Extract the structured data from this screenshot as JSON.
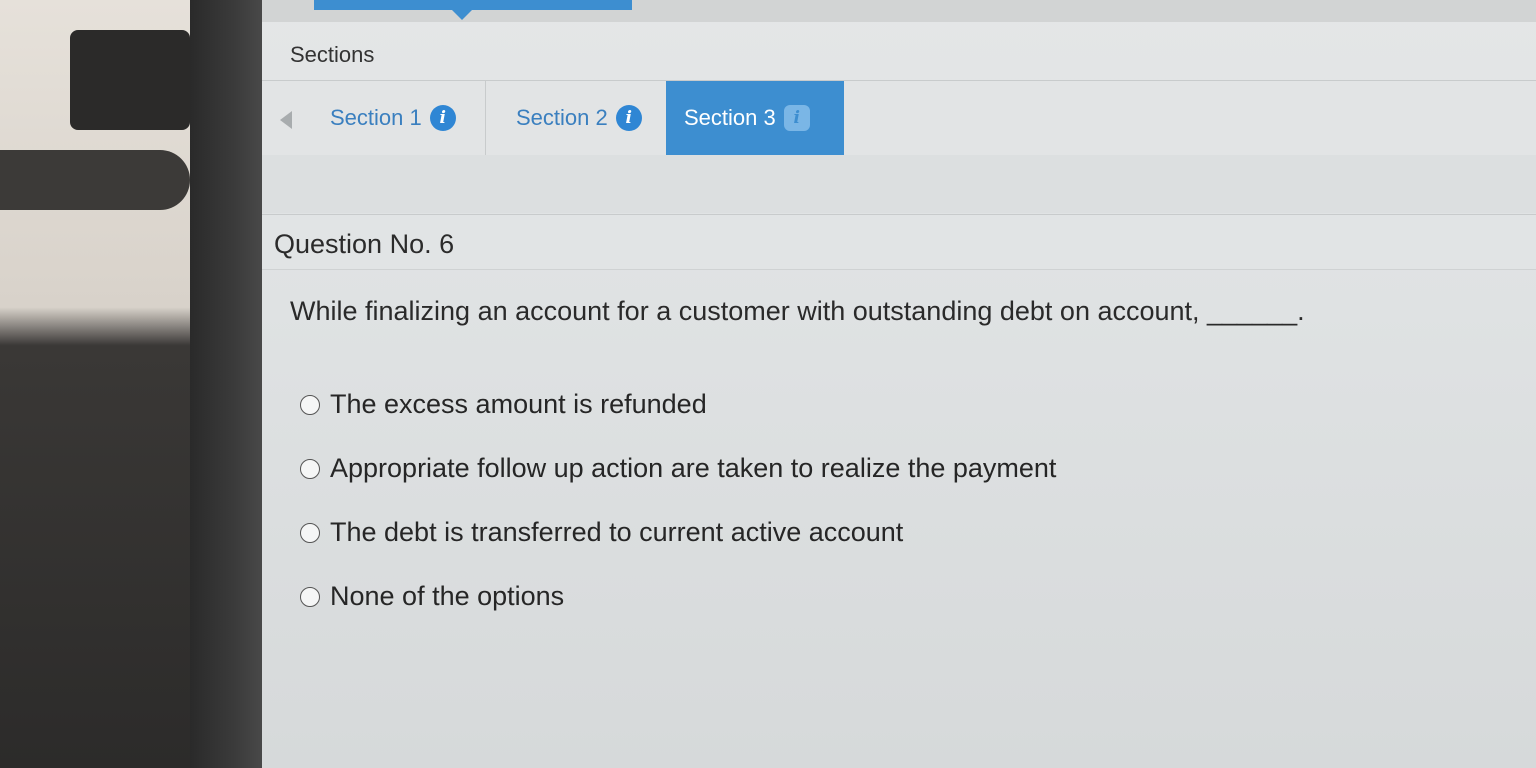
{
  "sections_title": "Sections",
  "tabs": [
    {
      "label": "Section 1",
      "active": false
    },
    {
      "label": "Section 2",
      "active": false
    },
    {
      "label": "Section 3",
      "active": true
    }
  ],
  "question": {
    "title": "Question No. 6",
    "text": "While finalizing an account for a customer with outstanding debt on account, ______."
  },
  "options": [
    "The excess amount is refunded",
    "Appropriate follow up action are taken to realize the payment",
    "The debt is transferred to current active account",
    "None of the options"
  ],
  "icons": {
    "info": "info-icon",
    "prev": "chevron-left-icon"
  },
  "colors": {
    "accent": "#3d8ed0",
    "tab_text": "#3a7fbf"
  }
}
